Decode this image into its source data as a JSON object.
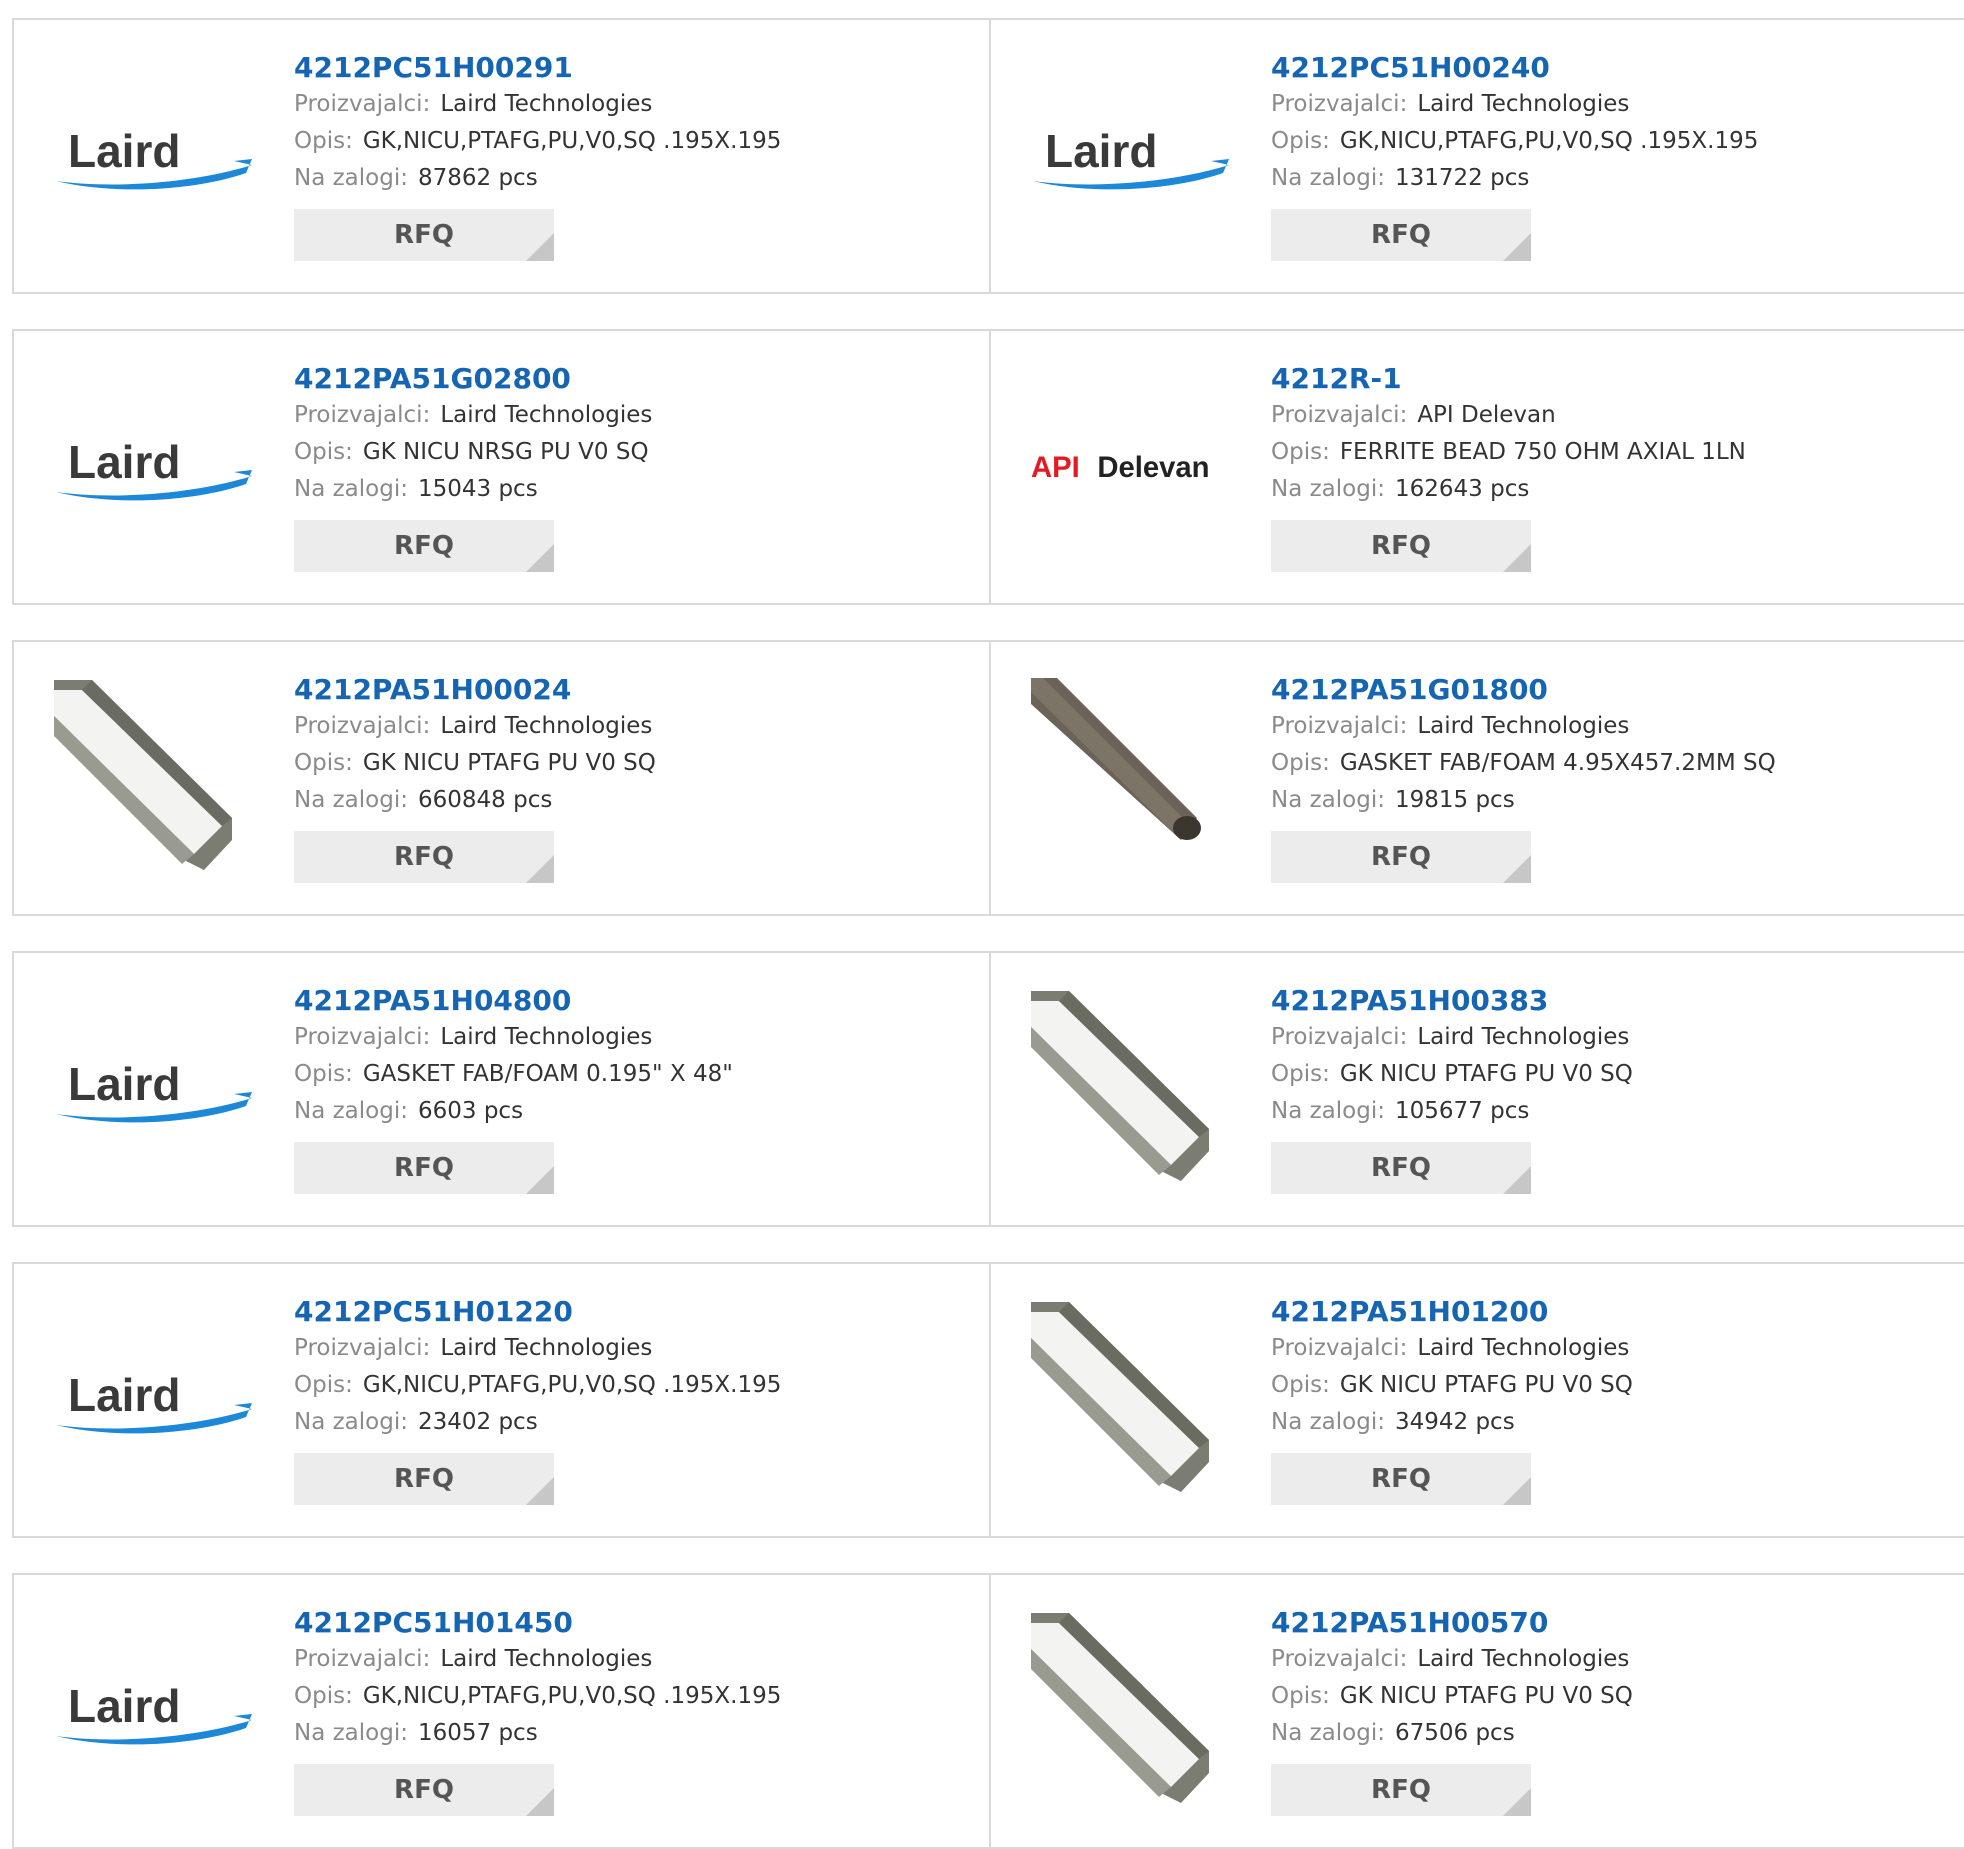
{
  "labels": {
    "manufacturer": "Proizvajalci:",
    "description": "Opis:",
    "stock": "Na zalogi:",
    "rfq": "RFQ"
  },
  "colors": {
    "part_link": "#1565b3",
    "laird_swoosh": "#1e88d8",
    "delevan_red": "#e21b23"
  },
  "products": [
    {
      "part": "4212PC51H00291",
      "manufacturer": "Laird Technologies",
      "description": "GK,NICU,PTAFG,PU,V0,SQ .195X.195",
      "stock": "87862 pcs",
      "image": "laird-logo"
    },
    {
      "part": "4212PC51H00240",
      "manufacturer": "Laird Technologies",
      "description": "GK,NICU,PTAFG,PU,V0,SQ .195X.195",
      "stock": "131722 pcs",
      "image": "laird-logo"
    },
    {
      "part": "4212PA51G02800",
      "manufacturer": "Laird Technologies",
      "description": "GK NICU NRSG PU V0 SQ",
      "stock": "15043 pcs",
      "image": "laird-logo"
    },
    {
      "part": "4212R-1",
      "manufacturer": "API Delevan",
      "description": "FERRITE BEAD 750 OHM AXIAL 1LN",
      "stock": "162643 pcs",
      "image": "api-delevan-logo",
      "logo_text": {
        "api": "API",
        "delevan": "Delevan"
      }
    },
    {
      "part": "4212PA51H00024",
      "manufacturer": "Laird Technologies",
      "description": "GK NICU PTAFG PU V0 SQ",
      "stock": "660848 pcs",
      "image": "gasket-photo"
    },
    {
      "part": "4212PA51G01800",
      "manufacturer": "Laird Technologies",
      "description": "GASKET FAB/FOAM 4.95X457.2MM SQ",
      "stock": "19815 pcs",
      "image": "foam-rod-photo"
    },
    {
      "part": "4212PA51H04800",
      "manufacturer": "Laird Technologies",
      "description": "GASKET FAB/FOAM 0.195\" X 48\"",
      "stock": "6603 pcs",
      "image": "laird-logo"
    },
    {
      "part": "4212PA51H00383",
      "manufacturer": "Laird Technologies",
      "description": "GK NICU PTAFG PU V0 SQ",
      "stock": "105677 pcs",
      "image": "gasket-photo"
    },
    {
      "part": "4212PC51H01220",
      "manufacturer": "Laird Technologies",
      "description": "GK,NICU,PTAFG,PU,V0,SQ .195X.195",
      "stock": "23402 pcs",
      "image": "laird-logo"
    },
    {
      "part": "4212PA51H01200",
      "manufacturer": "Laird Technologies",
      "description": "GK NICU PTAFG PU V0 SQ",
      "stock": "34942 pcs",
      "image": "gasket-photo"
    },
    {
      "part": "4212PC51H01450",
      "manufacturer": "Laird Technologies",
      "description": "GK,NICU,PTAFG,PU,V0,SQ .195X.195",
      "stock": "16057 pcs",
      "image": "laird-logo"
    },
    {
      "part": "4212PA51H00570",
      "manufacturer": "Laird Technologies",
      "description": "GK NICU PTAFG PU V0 SQ",
      "stock": "67506 pcs",
      "image": "gasket-photo"
    }
  ]
}
